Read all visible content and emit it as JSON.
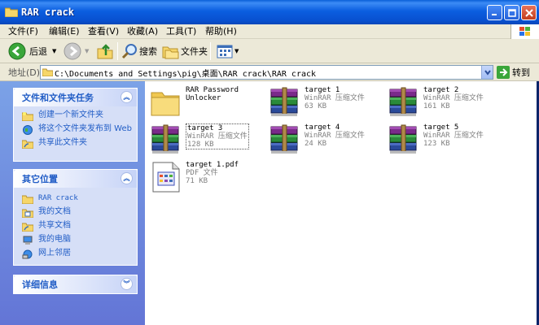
{
  "window": {
    "title": "RAR crack"
  },
  "menu": [
    "文件(F)",
    "编辑(E)",
    "查看(V)",
    "收藏(A)",
    "工具(T)",
    "帮助(H)"
  ],
  "toolbar": {
    "back": "后退",
    "search": "搜索",
    "folders": "文件夹"
  },
  "address": {
    "label": "地址(D)",
    "path": "C:\\Documents and Settings\\pig\\桌面\\RAR crack\\RAR crack",
    "go": "转到"
  },
  "tasks": {
    "title": "文件和文件夹任务",
    "items": [
      {
        "label": "创建一个新文件夹",
        "icon": "new-folder-icon"
      },
      {
        "label": "将这个文件夹发布到 Web",
        "icon": "publish-web-icon"
      },
      {
        "label": "共享此文件夹",
        "icon": "share-folder-icon"
      }
    ]
  },
  "places": {
    "title": "其它位置",
    "items": [
      {
        "label": "RAR crack",
        "icon": "folder-icon"
      },
      {
        "label": "我的文档",
        "icon": "my-documents-icon"
      },
      {
        "label": "共享文档",
        "icon": "shared-documents-icon"
      },
      {
        "label": "我的电脑",
        "icon": "my-computer-icon"
      },
      {
        "label": "网上邻居",
        "icon": "network-icon"
      }
    ]
  },
  "details": {
    "title": "详细信息"
  },
  "files": [
    {
      "name": "RAR Password",
      "name2": "Unlocker",
      "type": "",
      "size": "",
      "kind": "folder"
    },
    {
      "name": "target 1",
      "type": "WinRAR 压缩文件",
      "size": "63 KB",
      "kind": "rar"
    },
    {
      "name": "target 2",
      "type": "WinRAR 压缩文件",
      "size": "161 KB",
      "kind": "rar"
    },
    {
      "name": "target 3",
      "type": "WinRAR 压缩文件",
      "size": "128 KB",
      "kind": "rar",
      "selected": true
    },
    {
      "name": "target 4",
      "type": "WinRAR 压缩文件",
      "size": "24 KB",
      "kind": "rar"
    },
    {
      "name": "target 5",
      "type": "WinRAR 压缩文件",
      "size": "123 KB",
      "kind": "rar"
    },
    {
      "name": "target 1.pdf",
      "type": "PDF 文件",
      "size": "71 KB",
      "kind": "pdf"
    }
  ],
  "colors": {
    "titlebar": "#0b5ee0",
    "sidepanel": "#7ba2e7",
    "link": "#215dc6"
  }
}
